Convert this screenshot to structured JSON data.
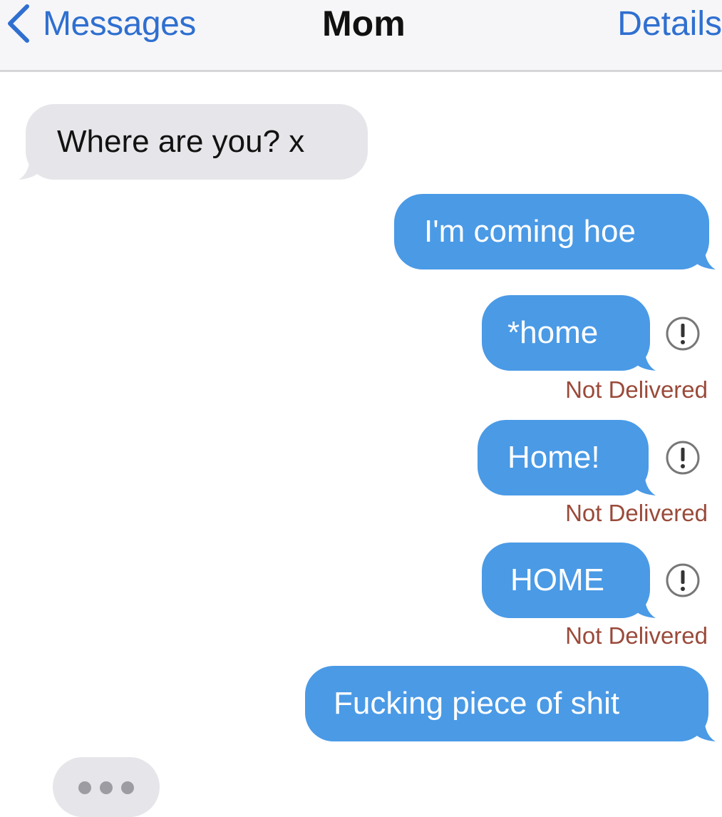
{
  "nav": {
    "back_label": "Messages",
    "title": "Mom",
    "details_label": "Details"
  },
  "messages": [
    {
      "direction": "incoming",
      "text": "Where are you? x"
    },
    {
      "direction": "outgoing",
      "text": "I'm coming hoe"
    },
    {
      "direction": "outgoing",
      "text": "*home",
      "status": "Not Delivered"
    },
    {
      "direction": "outgoing",
      "text": "Home!",
      "status": "Not Delivered"
    },
    {
      "direction": "outgoing",
      "text": "HOME",
      "status": "Not Delivered"
    },
    {
      "direction": "outgoing",
      "text": "Fucking piece of shit"
    }
  ],
  "typing_indicator": "incoming",
  "icons": {
    "back": "chevron-left-icon",
    "error": "exclamation-circle-icon"
  },
  "colors": {
    "accent": "#2f6fd0",
    "outgoing_bubble": "#4a9ae6",
    "incoming_bubble": "#e6e6ea",
    "status_text": "#9a4a3a"
  }
}
